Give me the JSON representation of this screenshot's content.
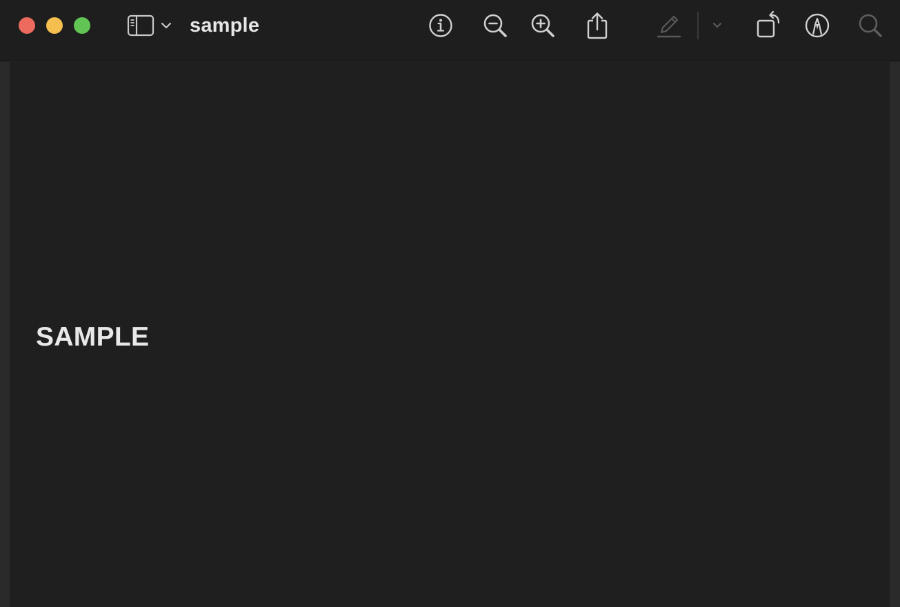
{
  "window": {
    "title": "sample"
  },
  "toolbar": {
    "icons": [
      "close-button",
      "minimize-button",
      "zoom-button",
      "sidebar-icon",
      "chevron-down-icon",
      "info-icon",
      "zoom-out-icon",
      "zoom-in-icon",
      "share-icon",
      "highlight-pen-icon",
      "chevron-down-icon",
      "rotate-icon",
      "markup-icon",
      "search-icon"
    ],
    "traffic_colors": {
      "close": "#ec6a5e",
      "minimize": "#f4bf4f",
      "zoom": "#61c554"
    }
  },
  "document": {
    "text": "SAMPLE"
  },
  "colors": {
    "titlebar": "#1e1e1e",
    "content": "#1f1f1f",
    "icon": "#d0d0d0",
    "icon_disabled": "#5a5a5a"
  }
}
